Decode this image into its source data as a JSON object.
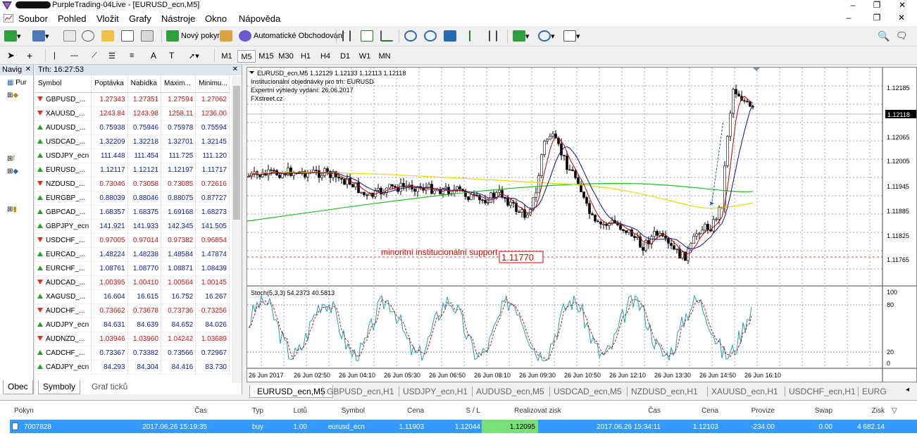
{
  "window": {
    "title": "PurpleTrading-04Live - [EURUSD_ecn,M5]",
    "controls": [
      "–",
      "❐",
      "✕"
    ]
  },
  "menu": [
    "Soubor",
    "Pohled",
    "Vložit",
    "Grafy",
    "Nástroje",
    "Okno",
    "Nápověda"
  ],
  "toolbar": {
    "new_order": "Nový pokyn",
    "auto_trading": "Automatické Obchodování"
  },
  "timeframes": [
    "M1",
    "M5",
    "M15",
    "M30",
    "H1",
    "H4",
    "D1",
    "W1",
    "MN"
  ],
  "active_timeframe": "M5",
  "navigator": {
    "title": "Navig",
    "item": "Pur"
  },
  "market_watch": {
    "title": "Trh: 16:27:53",
    "columns": [
      "Symbol",
      "Poptávka",
      "Nabídka",
      "Maxim...",
      "Minimu..."
    ],
    "rows": [
      {
        "dir": "down",
        "symbol": "GBPUSD_...",
        "bid": "1.27343",
        "ask": "1.27351",
        "high": "1.27594",
        "low": "1.27062"
      },
      {
        "dir": "down",
        "symbol": "XAUUSD_...",
        "bid": "1243.84",
        "ask": "1243.98",
        "high": "1258.11",
        "low": "1236.00"
      },
      {
        "dir": "up",
        "symbol": "AUDUSD_...",
        "bid": "0.75938",
        "ask": "0.75946",
        "high": "0.75978",
        "low": "0.75594"
      },
      {
        "dir": "up",
        "symbol": "USDCAD_...",
        "bid": "1.32209",
        "ask": "1.32218",
        "high": "1.32701",
        "low": "1.32145"
      },
      {
        "dir": "up",
        "symbol": "USDJPY_ecn",
        "bid": "111.448",
        "ask": "111.454",
        "high": "111.725",
        "low": "111.120"
      },
      {
        "dir": "up",
        "symbol": "EURUSD_...",
        "bid": "1.12117",
        "ask": "1.12121",
        "high": "1.12197",
        "low": "1.11717"
      },
      {
        "dir": "down",
        "symbol": "NZDUSD_...",
        "bid": "0.73046",
        "ask": "0.73058",
        "high": "0.73085",
        "low": "0.72616"
      },
      {
        "dir": "up",
        "symbol": "EURGBP_...",
        "bid": "0.88039",
        "ask": "0.88046",
        "high": "0.88075",
        "low": "0.87727"
      },
      {
        "dir": "up",
        "symbol": "GBPCAD_...",
        "bid": "1.68357",
        "ask": "1.68375",
        "high": "1.69168",
        "low": "1.68273"
      },
      {
        "dir": "up",
        "symbol": "GBPJPY_ecn",
        "bid": "141.921",
        "ask": "141.933",
        "high": "142.345",
        "low": "141.505"
      },
      {
        "dir": "down",
        "symbol": "USDCHF_...",
        "bid": "0.97005",
        "ask": "0.97014",
        "high": "0.97382",
        "low": "0.96854"
      },
      {
        "dir": "up",
        "symbol": "EURCAD_...",
        "bid": "1.48224",
        "ask": "1.48238",
        "high": "1.48584",
        "low": "1.47874"
      },
      {
        "dir": "up",
        "symbol": "EURCHF_...",
        "bid": "1.08761",
        "ask": "1.08770",
        "high": "1.08871",
        "low": "1.08439"
      },
      {
        "dir": "down",
        "symbol": "AUDCAD_...",
        "bid": "1.00395",
        "ask": "1.00410",
        "high": "1.00564",
        "low": "1.00145"
      },
      {
        "dir": "up",
        "symbol": "XAGUSD_...",
        "bid": "16.604",
        "ask": "16.615",
        "high": "16.752",
        "low": "16.267"
      },
      {
        "dir": "down",
        "symbol": "AUDCHF_...",
        "bid": "0.73662",
        "ask": "0.73678",
        "high": "0.73736",
        "low": "0.73256"
      },
      {
        "dir": "up",
        "symbol": "AUDJPY_ecn",
        "bid": "84.631",
        "ask": "84.639",
        "high": "84.652",
        "low": "84.026"
      },
      {
        "dir": "down",
        "symbol": "AUDNZD_...",
        "bid": "1.03946",
        "ask": "1.03960",
        "high": "1.04242",
        "low": "1.03689"
      },
      {
        "dir": "up",
        "symbol": "CADCHF_...",
        "bid": "0.73367",
        "ask": "0.73382",
        "high": "0.73566",
        "low": "0.72967"
      },
      {
        "dir": "up",
        "symbol": "CADJPY_ecn",
        "bid": "84.293",
        "ask": "84.304",
        "high": "84.416",
        "low": "83.730"
      }
    ],
    "tabs": [
      "Symboly",
      "Graf ticků"
    ],
    "nav_tab": "Obec"
  },
  "chart": {
    "header": "EURUSD_ecn,M5  1.12129 1.12133 1.12113 1.12118",
    "info_lines": [
      "Institucionální objednávky pro trh: EURUSD",
      "Expertní výhledy vydání: 26.06.2017",
      "FXstreet.cz"
    ],
    "annotation": "minoritní institucionální support",
    "level_label": "1.11770",
    "current_price": "1.12118",
    "price_ticks": [
      "1.12185",
      "1.12065",
      "1.12005",
      "1.11945",
      "1.11885",
      "1.11825",
      "1.11765"
    ],
    "time_ticks": [
      "26 Jun 2017",
      "26 Jun 02:50",
      "26 Jun 04:10",
      "26 Jun 05:30",
      "26 Jun 06:50",
      "26 Jun 08:10",
      "26 Jun 09:30",
      "26 Jun 10:50",
      "26 Jun 12:10",
      "26 Jun 13:30",
      "26 Jun 14:50",
      "26 Jun 16:10"
    ],
    "stoch_label": "Stoch(5,3,3) 54.2373 40.5813",
    "stoch_ticks": [
      "100",
      "80",
      "20",
      "0"
    ],
    "colors": {
      "ma_fast": "#c00000",
      "ma_mid": "#101080",
      "ma_slow": "#e8d800",
      "ma_long": "#20c020",
      "stoch_main": "#20a0b0",
      "stoch_signal": "#c01010",
      "annotation": "#e00000"
    }
  },
  "chart_tabs": [
    "EURUSD_ecn,M5",
    "GBPUSD_ecn,H1",
    "USDJPY_ecn,H1",
    "AUDUSD_ecn,M5",
    "USDCAD_ecn,M5",
    "NZDUSD_ecn,H1",
    "XAUUSD_ecn,H1",
    "USDCHF_ecn,H1",
    "EURG"
  ],
  "terminal": {
    "columns": [
      "Pokyn",
      "Čas",
      "Typ",
      "Lotů",
      "Symbol",
      "Cena",
      "S / L",
      "Realizovat zisk",
      "Čas",
      "Cena",
      "Provize",
      "Swap",
      "Zisk"
    ],
    "row": [
      "7007828",
      "2017.06.26 15:19:35",
      "buy",
      "1.00",
      "eurusd_ecn",
      "1.11903",
      "1.12044",
      "1.12095",
      "2017.06.26 15:34:11",
      "1.12103",
      "-234.00",
      "0.00",
      "4 682.14"
    ]
  }
}
